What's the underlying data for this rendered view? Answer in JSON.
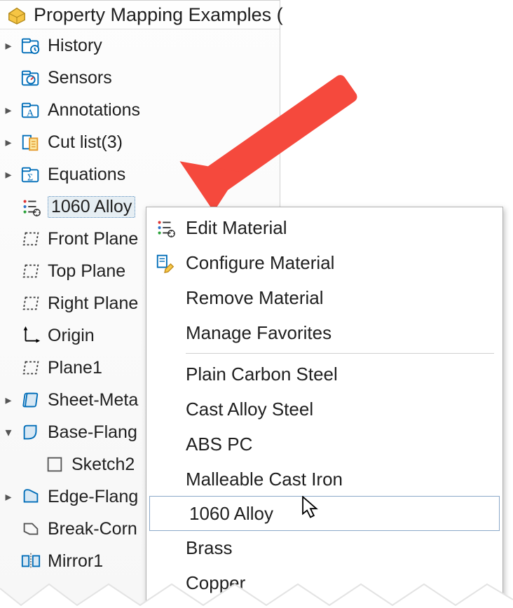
{
  "header": {
    "title": "Property Mapping Examples  ("
  },
  "tree": {
    "items": [
      {
        "label": "History",
        "expander": "▸",
        "icon": "folder-history"
      },
      {
        "label": "Sensors",
        "expander": "",
        "icon": "sensors"
      },
      {
        "label": "Annotations",
        "expander": "▸",
        "icon": "annotations"
      },
      {
        "label": "Cut list(3)",
        "expander": "▸",
        "icon": "cutlist"
      },
      {
        "label": "Equations",
        "expander": "▸",
        "icon": "equations"
      },
      {
        "label": "1060 Alloy",
        "expander": "",
        "icon": "material",
        "selected": true
      },
      {
        "label": "Front Plane",
        "expander": "",
        "icon": "plane"
      },
      {
        "label": "Top Plane",
        "expander": "",
        "icon": "plane"
      },
      {
        "label": "Right Plane",
        "expander": "",
        "icon": "plane"
      },
      {
        "label": "Origin",
        "expander": "",
        "icon": "origin"
      },
      {
        "label": "Plane1",
        "expander": "",
        "icon": "plane"
      },
      {
        "label": "Sheet-Meta",
        "expander": "▸",
        "icon": "sheetmetal"
      },
      {
        "label": "Base-Flang",
        "expander": "▾",
        "icon": "baseflange"
      },
      {
        "label": "Sketch2",
        "expander": "",
        "icon": "sketch",
        "indent": 1
      },
      {
        "label": "Edge-Flang",
        "expander": "▸",
        "icon": "edgeflange"
      },
      {
        "label": "Break-Corn",
        "expander": "",
        "icon": "breakcorner"
      },
      {
        "label": "Mirror1",
        "expander": "",
        "icon": "mirror"
      }
    ]
  },
  "menu": {
    "top_items": [
      {
        "label": "Edit Material",
        "icon": "material"
      },
      {
        "label": "Configure Material",
        "icon": "configure"
      },
      {
        "label": "Remove Material",
        "icon": ""
      },
      {
        "label": "Manage Favorites",
        "icon": ""
      }
    ],
    "fav_items": [
      {
        "label": "Plain Carbon Steel"
      },
      {
        "label": "Cast Alloy Steel"
      },
      {
        "label": "ABS PC"
      },
      {
        "label": "Malleable Cast Iron"
      },
      {
        "label": "1060 Alloy",
        "hover": true
      },
      {
        "label": "Brass"
      },
      {
        "label": "Copper"
      }
    ]
  },
  "colors": {
    "arrow": "#f5493d",
    "accent": "#006db8"
  }
}
